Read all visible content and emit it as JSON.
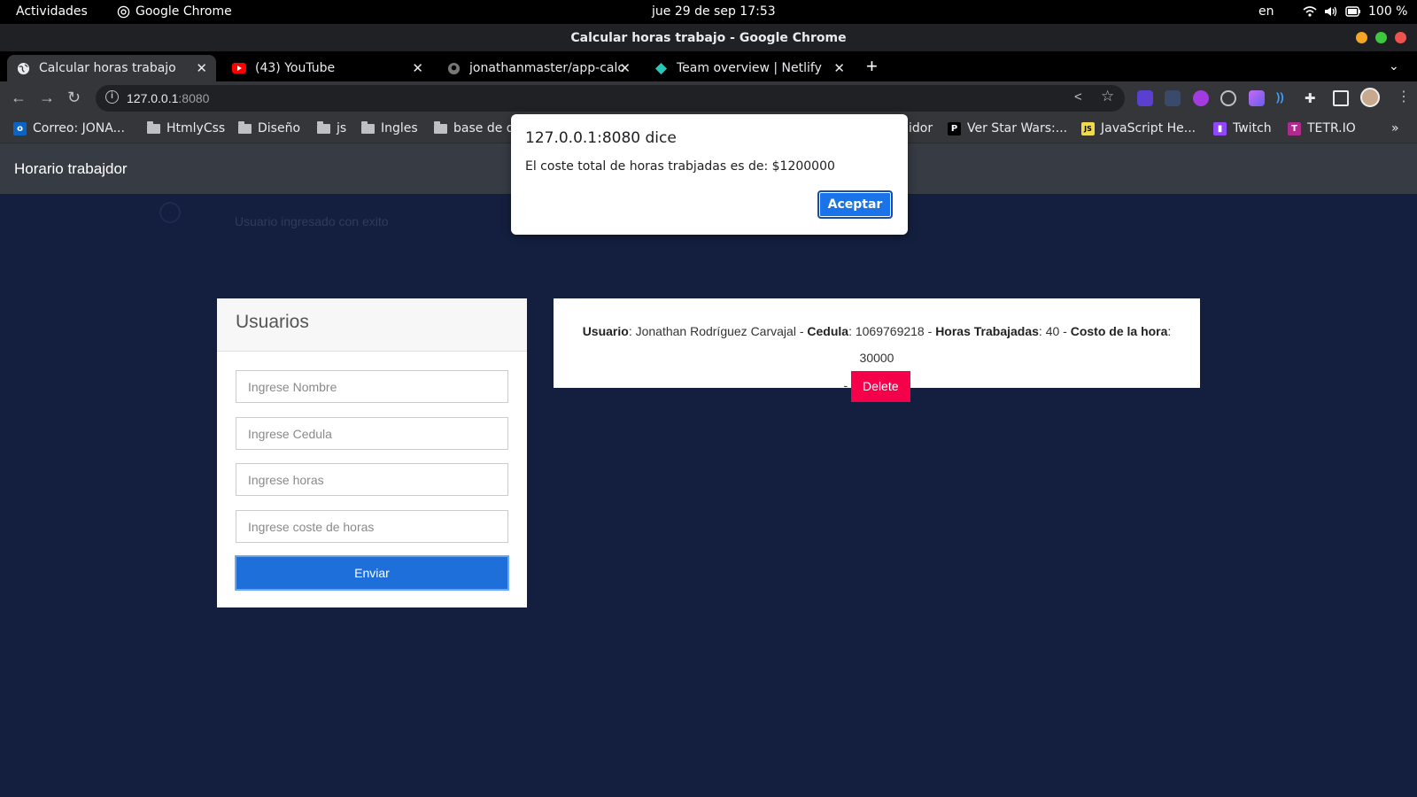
{
  "system": {
    "activities": "Actividades",
    "app_name": "Google Chrome",
    "clock": "jue 29 de sep  17:53",
    "lang": "en",
    "battery": "100 %"
  },
  "window": {
    "title": "Calcular horas trabajo - Google Chrome"
  },
  "tabs": [
    {
      "label": "Calcular horas trabajo"
    },
    {
      "label": "(43) YouTube"
    },
    {
      "label": "jonathanmaster/app-calc"
    },
    {
      "label": "Team overview | Netlify"
    }
  ],
  "address": {
    "host": "127.0.0.1",
    "port": ":8080"
  },
  "bookmarks": [
    {
      "label": "Correo: JONA..."
    },
    {
      "label": "HtmlyCss"
    },
    {
      "label": "Diseño"
    },
    {
      "label": "js"
    },
    {
      "label": "Ingles"
    },
    {
      "label": "base de d"
    },
    {
      "label": "idor"
    },
    {
      "label": "Ver Star Wars:..."
    },
    {
      "label": "JavaScript He..."
    },
    {
      "label": "Twitch"
    },
    {
      "label": "TETR.IO"
    },
    {
      "label": "»"
    }
  ],
  "app": {
    "brand": "Horario trabajdor",
    "ghost_message": "Usuario ingresado con exito"
  },
  "form": {
    "title": "Usuarios",
    "name_placeholder": "Ingrese Nombre",
    "id_placeholder": "Ingrese Cedula",
    "hours_placeholder": "Ingrese horas",
    "cost_placeholder": "Ingrese coste de horas",
    "submit": "Enviar"
  },
  "entry": {
    "user_label": "Usuario",
    "user": "Jonathan Rodríguez Carvajal",
    "id_label": "Cedula",
    "id": "1069769218",
    "hours_label": "Horas Trabajadas",
    "hours": "40",
    "cost_label": "Costo de la hora",
    "cost": "30000",
    "delete": "Delete"
  },
  "dialog": {
    "title": "127.0.0.1:8080 dice",
    "message": "El coste total de horas trabjadas es de:  $1200000",
    "ok": "Aceptar"
  },
  "colors": {
    "page_bg": "#141f3f",
    "primary": "#1e6fd9",
    "danger": "#f5004a",
    "navbar": "#363b44"
  }
}
